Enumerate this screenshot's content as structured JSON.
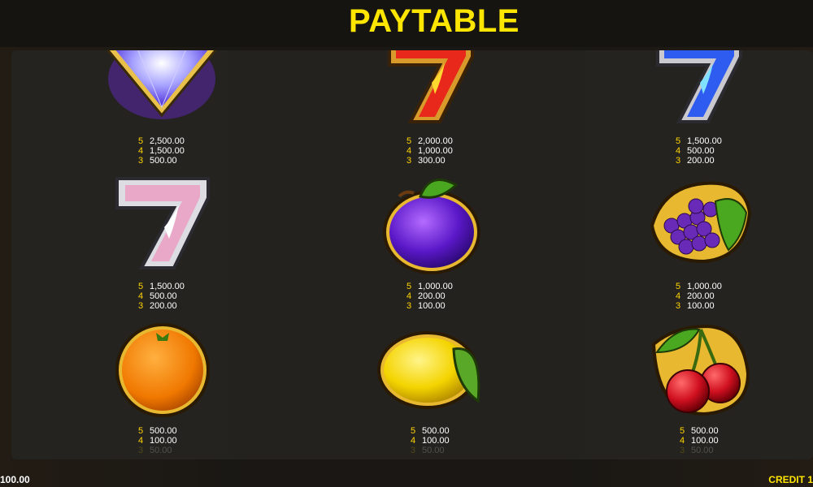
{
  "title": "PAYTABLE",
  "symbols": [
    {
      "icon": "diamond-icon",
      "pays": [
        {
          "n": "5",
          "v": "2,500.00"
        },
        {
          "n": "4",
          "v": "1,500.00"
        },
        {
          "n": "3",
          "v": "500.00"
        }
      ]
    },
    {
      "icon": "red-seven-icon",
      "pays": [
        {
          "n": "5",
          "v": "2,000.00"
        },
        {
          "n": "4",
          "v": "1,000.00"
        },
        {
          "n": "3",
          "v": "300.00"
        }
      ]
    },
    {
      "icon": "blue-seven-icon",
      "pays": [
        {
          "n": "5",
          "v": "1,500.00"
        },
        {
          "n": "4",
          "v": "500.00"
        },
        {
          "n": "3",
          "v": "200.00"
        }
      ]
    },
    {
      "icon": "silver-seven-icon",
      "pays": [
        {
          "n": "5",
          "v": "1,500.00"
        },
        {
          "n": "4",
          "v": "500.00"
        },
        {
          "n": "3",
          "v": "200.00"
        }
      ]
    },
    {
      "icon": "plum-icon",
      "pays": [
        {
          "n": "5",
          "v": "1,000.00"
        },
        {
          "n": "4",
          "v": "200.00"
        },
        {
          "n": "3",
          "v": "100.00"
        }
      ]
    },
    {
      "icon": "grapes-icon",
      "pays": [
        {
          "n": "5",
          "v": "1,000.00"
        },
        {
          "n": "4",
          "v": "200.00"
        },
        {
          "n": "3",
          "v": "100.00"
        }
      ]
    },
    {
      "icon": "orange-icon",
      "pays": [
        {
          "n": "5",
          "v": "500.00"
        },
        {
          "n": "4",
          "v": "100.00"
        },
        {
          "n": "3",
          "v": "50.00"
        }
      ]
    },
    {
      "icon": "lemon-icon",
      "pays": [
        {
          "n": "5",
          "v": "500.00"
        },
        {
          "n": "4",
          "v": "100.00"
        },
        {
          "n": "3",
          "v": "50.00"
        }
      ]
    },
    {
      "icon": "cherries-icon",
      "pays": [
        {
          "n": "5",
          "v": "500.00"
        },
        {
          "n": "4",
          "v": "100.00"
        },
        {
          "n": "3",
          "v": "50.00"
        }
      ]
    }
  ],
  "footer": {
    "balance_fragment": "100.00",
    "credit_label": "CREDIT",
    "credit_fragment": "1"
  }
}
